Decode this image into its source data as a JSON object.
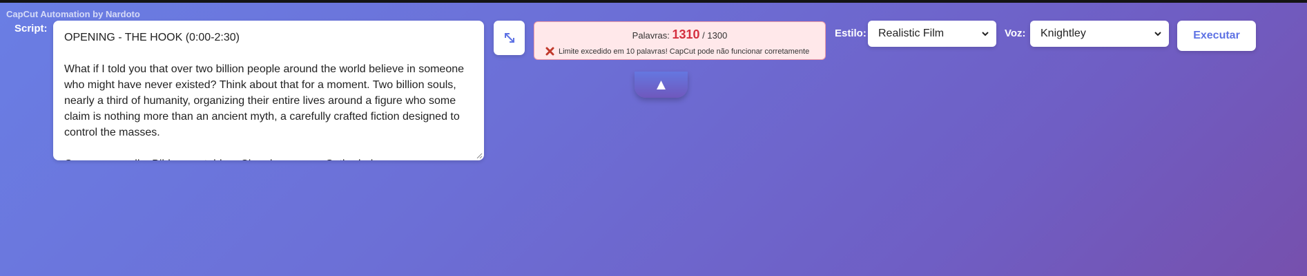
{
  "app": {
    "title": "CapCut Automation by Nardoto"
  },
  "script": {
    "label": "Script:",
    "value": "OPENING - THE HOOK (0:00-2:30)\n\nWhat if I told you that over two billion people around the world believe in someone who might have never existed? Think about that for a moment. Two billion souls, nearly a third of humanity, organizing their entire lives around a figure who some claim is nothing more than an ancient myth, a carefully crafted fiction designed to control the masses.\n\nCross on a wall... Bible on a table... Church... ... ... ... Cathedral..."
  },
  "word_counter": {
    "label": "Palavras:",
    "current": "1310",
    "limit": "/ 1300",
    "warning": "Limite excedido em 10 palavras! CapCut pode não funcionar corretamente",
    "current_color": "#d42f3f"
  },
  "style": {
    "label": "Estilo:",
    "selected": "Realistic Film"
  },
  "voice": {
    "label": "Voz:",
    "selected": "Knightley"
  },
  "actions": {
    "run_label": "Executar",
    "collapse_label": "▲"
  },
  "icons": {
    "expand": "expand-arrows-icon",
    "warning": "red-x-icon",
    "chevron": "chevron-down-icon",
    "collapse": "triangle-up-icon"
  }
}
